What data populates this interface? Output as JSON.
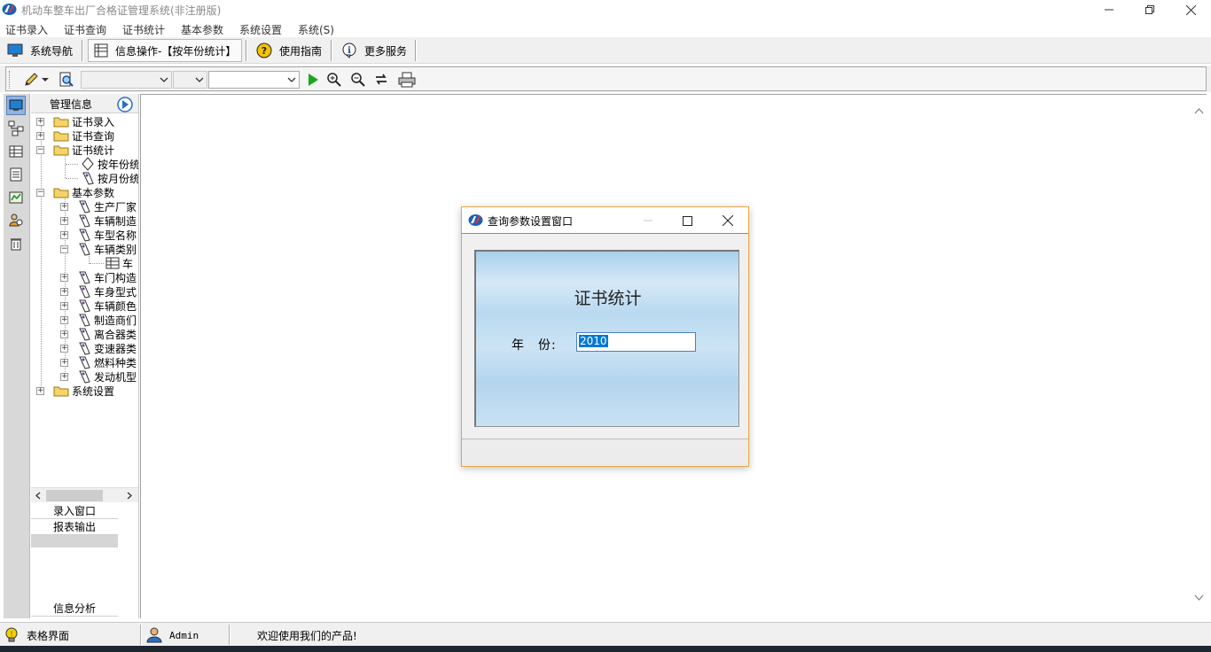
{
  "window": {
    "title": "机动车整车出厂合格证管理系统(非注册版)"
  },
  "menu": [
    {
      "label": "证书录入"
    },
    {
      "label": "证书查询"
    },
    {
      "label": "证书统计"
    },
    {
      "label": "基本参数"
    },
    {
      "label": "系统设置"
    },
    {
      "label": "系统(S)"
    }
  ],
  "navbar": {
    "nav": "系统导航",
    "info": "信息操作-【按年份统计】",
    "guide": "使用指南",
    "more": "更多服务"
  },
  "toolbar": {
    "icons": [
      "pencil-icon",
      "preview-icon",
      "play-icon",
      "zoom-in-icon",
      "zoom-out-icon",
      "refresh-icon",
      "print-icon"
    ],
    "combo1_value": "",
    "combo2_value": "",
    "combo3_value": ""
  },
  "tree": {
    "title": "管理信息",
    "nodes": [
      {
        "label": "证书录入"
      },
      {
        "label": "证书查询"
      },
      {
        "label": "证书统计"
      },
      {
        "label": "按年份统"
      },
      {
        "label": "按月份统"
      },
      {
        "label": "基本参数"
      },
      {
        "label": "生产厂家"
      },
      {
        "label": "车辆制造"
      },
      {
        "label": "车型名称"
      },
      {
        "label": "车辆类别"
      },
      {
        "label": "车"
      },
      {
        "label": "车门构造"
      },
      {
        "label": "车身型式"
      },
      {
        "label": "车辆颜色"
      },
      {
        "label": "制造商们"
      },
      {
        "label": "离合器类"
      },
      {
        "label": "变速器类"
      },
      {
        "label": "燃料种类"
      },
      {
        "label": "发动机型"
      },
      {
        "label": "系统设置"
      }
    ],
    "tabs": [
      "录入窗口",
      "报表输出",
      "信息分析"
    ]
  },
  "dialog": {
    "title": "查询参数设置窗口",
    "heading": "证书统计",
    "year_label": "年　份:",
    "year_value": "2010"
  },
  "status": {
    "view": "表格界面",
    "user": "Admin",
    "message": "欢迎使用我们的产品!"
  }
}
